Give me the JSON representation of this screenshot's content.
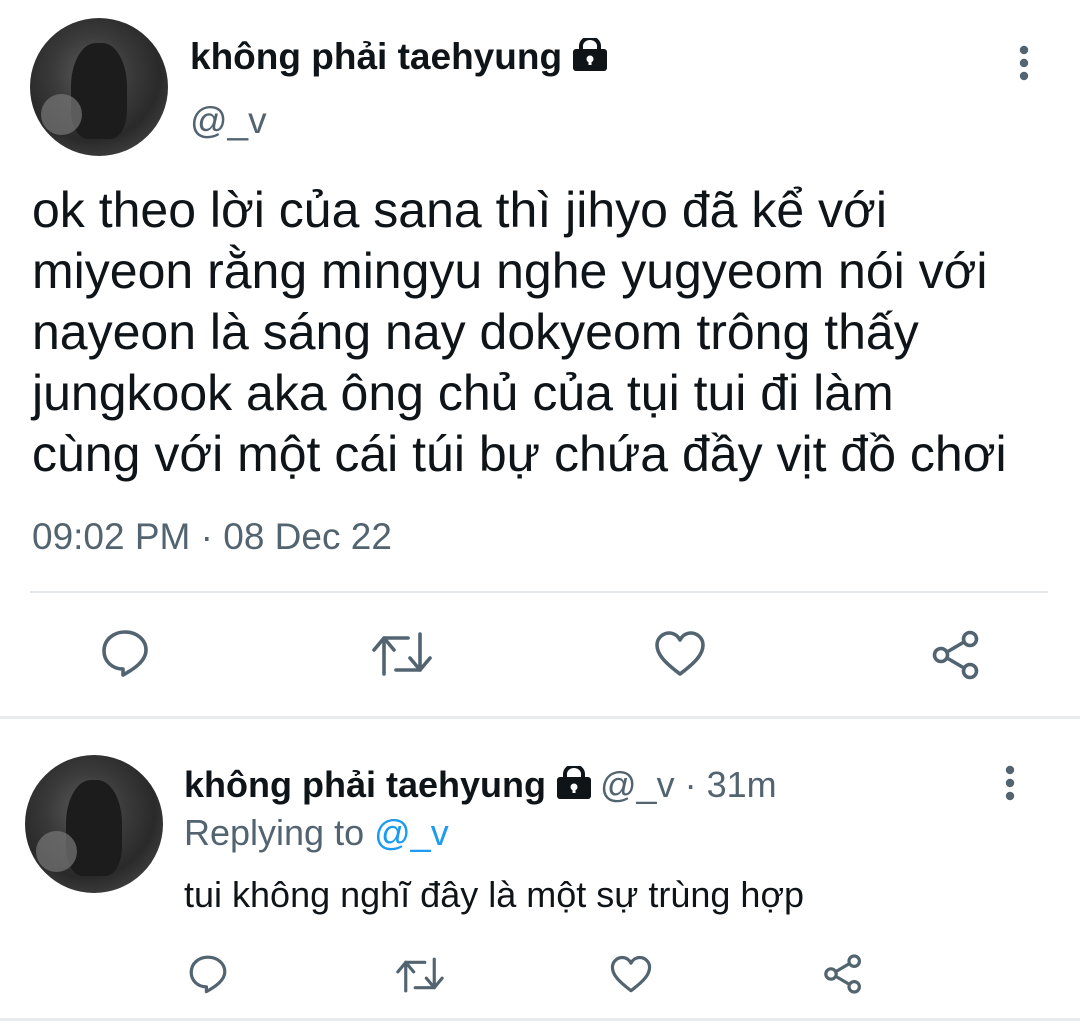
{
  "tweet": {
    "author_name": "không phải taehyung",
    "author_handle": "@_v",
    "text_lines": [
      "ok theo lời của sana thì jihyo đã kể với",
      "miyeon rằng mingyu nghe yugyeom nói với",
      "nayeon là sáng nay dokyeom trông thấy",
      "jungkook aka ông chủ của tụi tui đi làm",
      "cùng với một cái túi bự chứa đầy vịt đồ chơi"
    ],
    "timestamp": "09:02 PM · 08 Dec 22",
    "actions": [
      "reply-icon",
      "retweet-icon",
      "like-icon",
      "share-icon"
    ]
  },
  "reply": {
    "author_name": "không phải taehyung",
    "meta": "@_v · 31m",
    "replying_prefix": "Replying to",
    "replying_mention": "@_v",
    "text": "tui không nghĩ đây là một sự trùng hợp",
    "actions": [
      "reply-icon",
      "retweet-icon",
      "like-icon",
      "share-icon"
    ]
  },
  "colors": {
    "primary_text": "#0f1419",
    "secondary_text": "#536471",
    "link": "#1d9bf0",
    "divider": "#e4e8eb"
  }
}
